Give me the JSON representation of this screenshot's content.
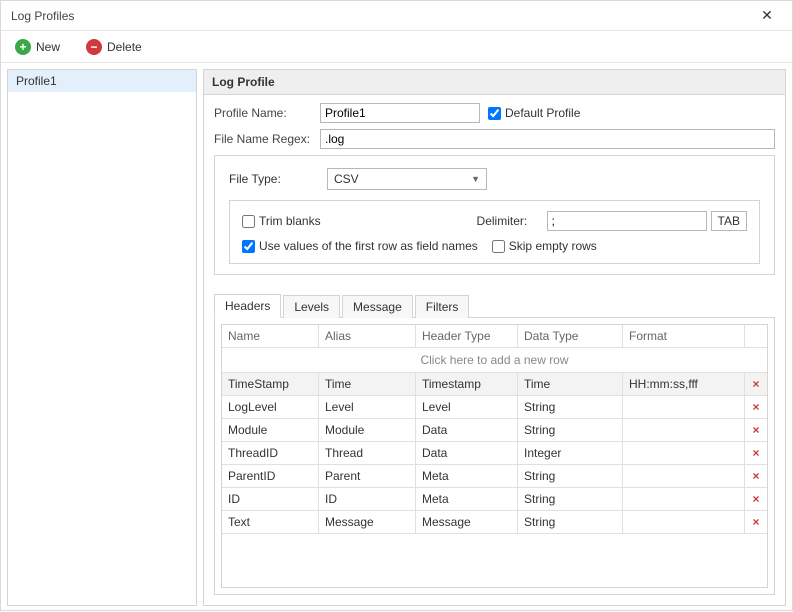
{
  "window": {
    "title": "Log Profiles"
  },
  "toolbar": {
    "new_label": "New",
    "delete_label": "Delete"
  },
  "sidebar": {
    "items": [
      "Profile1"
    ],
    "selected": 0
  },
  "panel": {
    "title": "Log Profile"
  },
  "form": {
    "profile_name_label": "Profile Name:",
    "profile_name_value": "Profile1",
    "default_profile_label": "Default Profile",
    "default_profile_checked": true,
    "regex_label": "File Name Regex:",
    "regex_value": ".log"
  },
  "filetype": {
    "label": "File Type:",
    "value": "CSV",
    "trim_blanks_label": "Trim blanks",
    "trim_blanks_checked": false,
    "delimiter_label": "Delimiter:",
    "delimiter_value": ";",
    "tab_btn": "TAB",
    "first_row_label": "Use values of the first row as field names",
    "first_row_checked": true,
    "skip_empty_label": "Skip empty rows",
    "skip_empty_checked": false
  },
  "tabs": {
    "items": [
      "Headers",
      "Levels",
      "Message",
      "Filters"
    ],
    "active": 0
  },
  "grid": {
    "columns": [
      "Name",
      "Alias",
      "Header Type",
      "Data Type",
      "Format"
    ],
    "newrow_hint": "Click here to add a new row",
    "rows": [
      {
        "name": "TimeStamp",
        "alias": "Time",
        "htype": "Timestamp",
        "dtype": "Time",
        "fmt": "HH:mm:ss,fff"
      },
      {
        "name": "LogLevel",
        "alias": "Level",
        "htype": "Level",
        "dtype": "String",
        "fmt": ""
      },
      {
        "name": "Module",
        "alias": "Module",
        "htype": "Data",
        "dtype": "String",
        "fmt": ""
      },
      {
        "name": "ThreadID",
        "alias": "Thread",
        "htype": "Data",
        "dtype": "Integer",
        "fmt": ""
      },
      {
        "name": "ParentID",
        "alias": "Parent",
        "htype": "Meta",
        "dtype": "String",
        "fmt": ""
      },
      {
        "name": "ID",
        "alias": "ID",
        "htype": "Meta",
        "dtype": "String",
        "fmt": ""
      },
      {
        "name": "Text",
        "alias": "Message",
        "htype": "Message",
        "dtype": "String",
        "fmt": ""
      }
    ]
  }
}
